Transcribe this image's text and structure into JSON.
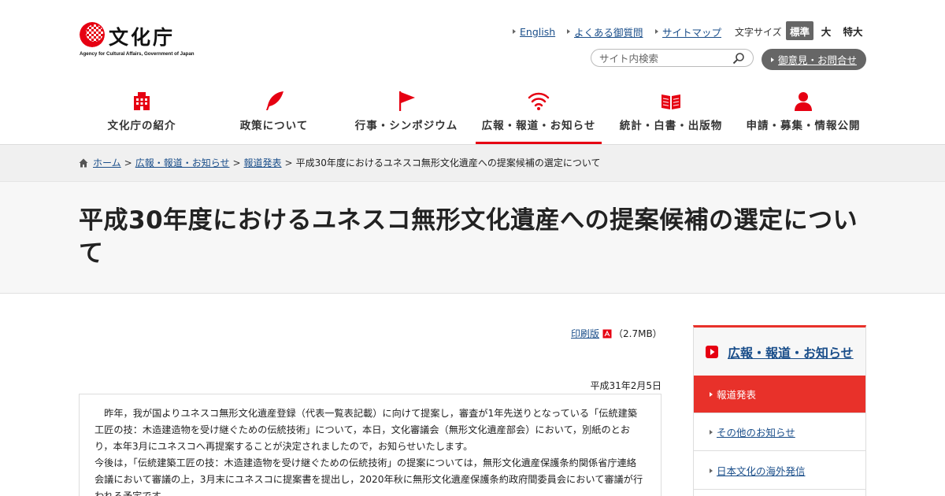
{
  "logo": {
    "text": "文化庁",
    "subtitle": "Agency for Cultural Affairs, Government of Japan"
  },
  "utility": {
    "links": [
      "English",
      "よくある御質問",
      "サイトマップ"
    ],
    "font_size_label": "文字サイズ",
    "font_sizes": [
      "標準",
      "大",
      "特大"
    ],
    "search_placeholder": "サイト内検索",
    "opinion_label": "御意見・お問合せ"
  },
  "nav": [
    {
      "label": "文化庁の紹介",
      "icon": "building-icon"
    },
    {
      "label": "政策について",
      "icon": "feather-icon"
    },
    {
      "label": "行事・シンポジウム",
      "icon": "flag-icon"
    },
    {
      "label": "広報・報道・お知らせ",
      "icon": "wifi-icon",
      "active": true
    },
    {
      "label": "統計・白書・出版物",
      "icon": "book-icon"
    },
    {
      "label": "申請・募集・情報公開",
      "icon": "person-icon"
    }
  ],
  "breadcrumb": [
    "ホーム",
    "広報・報道・お知らせ",
    "報道発表",
    "平成30年度におけるユネスコ無形文化遺産への提案候補の選定について"
  ],
  "page_title": "平成30年度におけるユネスコ無形文化遺産への提案候補の選定について",
  "print": {
    "label": "印刷版",
    "size": "（2.7MB）"
  },
  "date": "平成31年2月5日",
  "body": [
    "　昨年，我が国よりユネスコ無形文化遺産登録（代表一覧表記載）に向けて提案し，審査が1年先送りとなっている「伝統建築工匠の技：木造建造物を受け継ぐための伝統技術」について，本日，文化審議会（無形文化遺産部会）において，別紙のとおり，本年3月にユネスコへ再提案することが決定されましたので，お知らせいたします。",
    "今後は，「伝統建築工匠の技：木造建造物を受け継ぐための伝統技術」の提案については，無形文化遺産保護条約関係省庁連絡会議において審議の上，3月末にユネスコに提案書を提出し，2020年秋に無形文化遺産保護条約政府間委員会において審議が行われる予定です。"
  ],
  "side": {
    "heading": "広報・報道・お知らせ",
    "items": [
      "報道発表",
      "その他のお知らせ",
      "日本文化の海外発信"
    ]
  },
  "colors": {
    "accent": "#e60012",
    "link": "#1a4e8a",
    "gray_button": "#666666"
  }
}
